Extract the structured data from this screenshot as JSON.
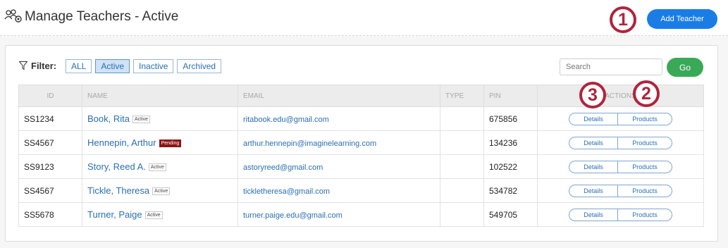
{
  "header": {
    "title": "Manage Teachers - Active",
    "add_button": "Add Teacher",
    "icon": "teachers-icon"
  },
  "callouts": [
    "1",
    "2",
    "3"
  ],
  "filter": {
    "label": "Filter:",
    "options": [
      "ALL",
      "Active",
      "Inactive",
      "Archived"
    ],
    "selected": "Active"
  },
  "search": {
    "placeholder": "Search",
    "go_label": "Go"
  },
  "table": {
    "columns": [
      "ID",
      "NAME",
      "EMAIL",
      "TYPE",
      "PIN",
      "ACTIONS"
    ],
    "rows": [
      {
        "id": "SS1234",
        "name": "Book, Rita",
        "status": "Active",
        "email": "ritabook.edu@gmail.com",
        "type": "",
        "pin": "675856"
      },
      {
        "id": "SS4567",
        "name": "Hennepin, Arthur",
        "status": "Pending",
        "email": "arthur.hennepin@imaginelearning.com",
        "type": "",
        "pin": "134236"
      },
      {
        "id": "SS9123",
        "name": "Story, Reed A.",
        "status": "Active",
        "email": "astoryreed@gmail.com",
        "type": "",
        "pin": "102522"
      },
      {
        "id": "SS4567",
        "name": "Tickle, Theresa",
        "status": "Active",
        "email": "tickletheresa@gmail.com",
        "type": "",
        "pin": "534782"
      },
      {
        "id": "SS5678",
        "name": "Turner, Paige",
        "status": "Active",
        "email": "turner.paige.edu@gmail.com",
        "type": "",
        "pin": "549705"
      }
    ],
    "details_label": "Details",
    "products_label": "Products"
  },
  "colors": {
    "accent": "#1a7de6",
    "go": "#3aa957",
    "callout": "#b0243c",
    "pending": "#8b1414"
  }
}
